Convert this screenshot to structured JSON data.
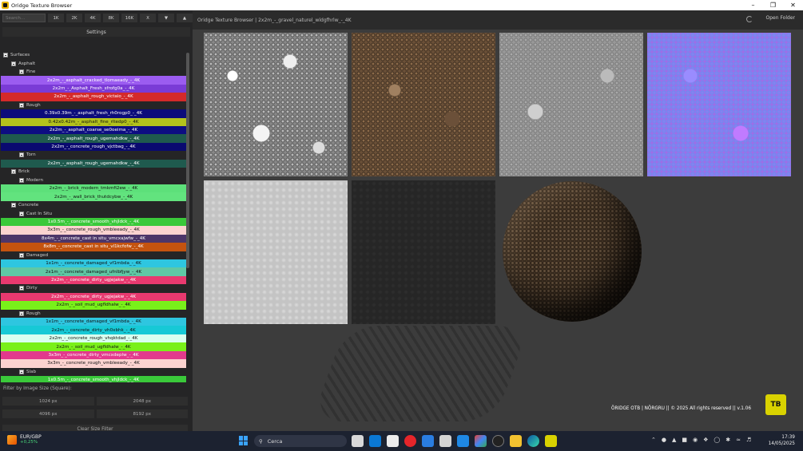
{
  "window": {
    "title": "Oridge Texture Browser"
  },
  "toolbar": {
    "search_placeholder": "Search...",
    "sizes": [
      "1K",
      "2K",
      "4K",
      "8K",
      "16K",
      "X"
    ],
    "settings_label": "Settings"
  },
  "tree": [
    {
      "kind": "folder",
      "level": 0,
      "label": "Surfaces"
    },
    {
      "kind": "folder",
      "level": 1,
      "label": "Asphalt"
    },
    {
      "kind": "folder",
      "level": 2,
      "label": "Fine"
    },
    {
      "kind": "item",
      "label": "2x2m_-_asphalt_cracked_tlomaeady_-_4K",
      "bg": "#9b5cf0",
      "fg": "#ffffff"
    },
    {
      "kind": "item",
      "label": "2x2m_-_Asphalt_Fresh_sfrofg0a_-_4K",
      "bg": "#7a3bd6",
      "fg": "#ffffff"
    },
    {
      "kind": "item",
      "label": "2x2m_-_asphalt_rough_victaio_-_4K",
      "bg": "#d42a2a",
      "fg": "#ffffff"
    },
    {
      "kind": "folder",
      "level": 2,
      "label": "Rough"
    },
    {
      "kind": "item",
      "label": "0.39x0.39m_-_asphalt_fresh_rh0rogp0_-_4K",
      "bg": "#0c0c7a",
      "fg": "#ffffff"
    },
    {
      "kind": "item",
      "label": "0.42x0.42m_-_asphalt_fine_rltedp0_-_4K",
      "bg": "#b3c21c",
      "fg": "#111111"
    },
    {
      "kind": "item",
      "label": "2x2m_-_asphalt_coarse_se0oeima_-_4K",
      "bg": "#0d0d82",
      "fg": "#ffffff"
    },
    {
      "kind": "item",
      "label": "2x2m_-_asphalt_rough_ugemahdkw_-_4K",
      "bg": "#1f5a4e",
      "fg": "#ffffff"
    },
    {
      "kind": "item",
      "label": "2x2m_-_concrete_rough_vjctbag_-_4K",
      "bg": "#0a0a70",
      "fg": "#ffffff"
    },
    {
      "kind": "folder",
      "level": 2,
      "label": "Torn"
    },
    {
      "kind": "item",
      "label": "2x2m_-_asphalt_rough_ugemahdkw_-_4K",
      "bg": "#1f5a4e",
      "fg": "#ffffff"
    },
    {
      "kind": "folder",
      "level": 1,
      "label": "Brick"
    },
    {
      "kind": "folder",
      "level": 2,
      "label": "Modern"
    },
    {
      "kind": "item",
      "label": "2x2m_-_brick_modern_tmkmfi2ew_-_4K",
      "bg": "#5de07a",
      "fg": "#111111"
    },
    {
      "kind": "item",
      "label": "2x2m_-_wall_brick_thutdcybw_-_4K",
      "bg": "#62e37e",
      "fg": "#111111"
    },
    {
      "kind": "folder",
      "level": 1,
      "label": "Concrete"
    },
    {
      "kind": "folder",
      "level": 2,
      "label": "Cast In Situ"
    },
    {
      "kind": "item",
      "label": "1x0.5m_-_concrete_smooth_vhjldck_-_4K",
      "bg": "#3ac93a",
      "fg": "#ffffff"
    },
    {
      "kind": "item",
      "label": "3x3m_-_concrete_rough_vmbleeady_-_4K",
      "bg": "#fbd3d0",
      "fg": "#111111"
    },
    {
      "kind": "item",
      "label": "8x4m_-_concrete_cast in situ_vmcxajwfw_-_4K",
      "bg": "#4c3669",
      "fg": "#ffffff"
    },
    {
      "kind": "item",
      "label": "8x8m_-_concrete_cast in situ_vl1kcfofw_-_4K",
      "bg": "#c4530f",
      "fg": "#ffffff"
    },
    {
      "kind": "folder",
      "level": 2,
      "label": "Damaged"
    },
    {
      "kind": "item",
      "label": "1x1m_-_concrete_damaged_vf1mbda_-_4K",
      "bg": "#2ec6e0",
      "fg": "#111111"
    },
    {
      "kind": "item",
      "label": "2x1m_-_concrete_damaged_ufnlbfjyw_-_4K",
      "bg": "#5fc8a5",
      "fg": "#111111"
    },
    {
      "kind": "item",
      "label": "2x2m_-_concrete_dirty_ugjejakw_-_4K",
      "bg": "#e8396f",
      "fg": "#ffffff"
    },
    {
      "kind": "folder",
      "level": 2,
      "label": "Dirty"
    },
    {
      "kind": "item",
      "label": "2x2m_-_concrete_dirty_ugjejakw_-_4K",
      "bg": "#e8396f",
      "fg": "#ffffff"
    },
    {
      "kind": "item",
      "label": "2x2m_-_soil_mud_ugfldhalw_-_4K",
      "bg": "#79f01a",
      "fg": "#111111"
    },
    {
      "kind": "folder",
      "level": 2,
      "label": "Rough"
    },
    {
      "kind": "item",
      "label": "1x1m_-_concrete_damaged_vf1mbda_-_4K",
      "bg": "#2ec6e0",
      "fg": "#111111"
    },
    {
      "kind": "item",
      "label": "2x2m_-_concrete_dirty_vh0xbhk_-_4K",
      "bg": "#17c9d6",
      "fg": "#111111"
    },
    {
      "kind": "item",
      "label": "2x2m_-_concrete_rough_vhqktdad_-_4K",
      "bg": "#d9fff0",
      "fg": "#111111"
    },
    {
      "kind": "item",
      "label": "2x2m_-_soil_mud_ugfldhalw_-_4K",
      "bg": "#79f01a",
      "fg": "#111111"
    },
    {
      "kind": "item",
      "label": "3x3m_-_concrete_dirty_vmcxdeplw_-_4K",
      "bg": "#e23a8c",
      "fg": "#ffffff"
    },
    {
      "kind": "item",
      "label": "3x3m_-_concrete_rough_vmbleeady_-_4K",
      "bg": "#fbd3d0",
      "fg": "#111111"
    },
    {
      "kind": "folder",
      "level": 2,
      "label": "Slab"
    },
    {
      "kind": "item",
      "label": "1x0.5m_-_concrete_smooth_vhjldck_-_4K",
      "bg": "#3ac93a",
      "fg": "#ffffff"
    }
  ],
  "filter": {
    "label": "Filter by Image Size (Square):",
    "options": [
      "1024 px",
      "2048 px",
      "4096 px",
      "8192 px"
    ],
    "clear_label": "Clear Size Filter"
  },
  "main": {
    "path": "Oridge Texture Browser | 2x2m_-_gravel_naturel_wldgfhrlw_-_4K",
    "open_folder": "Open Folder",
    "footer": "ÖRIDGE OTB  |  NÖRGRU  ||  © 2025  All rights reserved  ||  v.1.06",
    "logo_text": "TB"
  },
  "taskbar": {
    "weather_title": "EUR/GBP",
    "weather_value": "+0,25%",
    "search": "Cerca",
    "time": "17:39",
    "date": "14/05/2025"
  }
}
